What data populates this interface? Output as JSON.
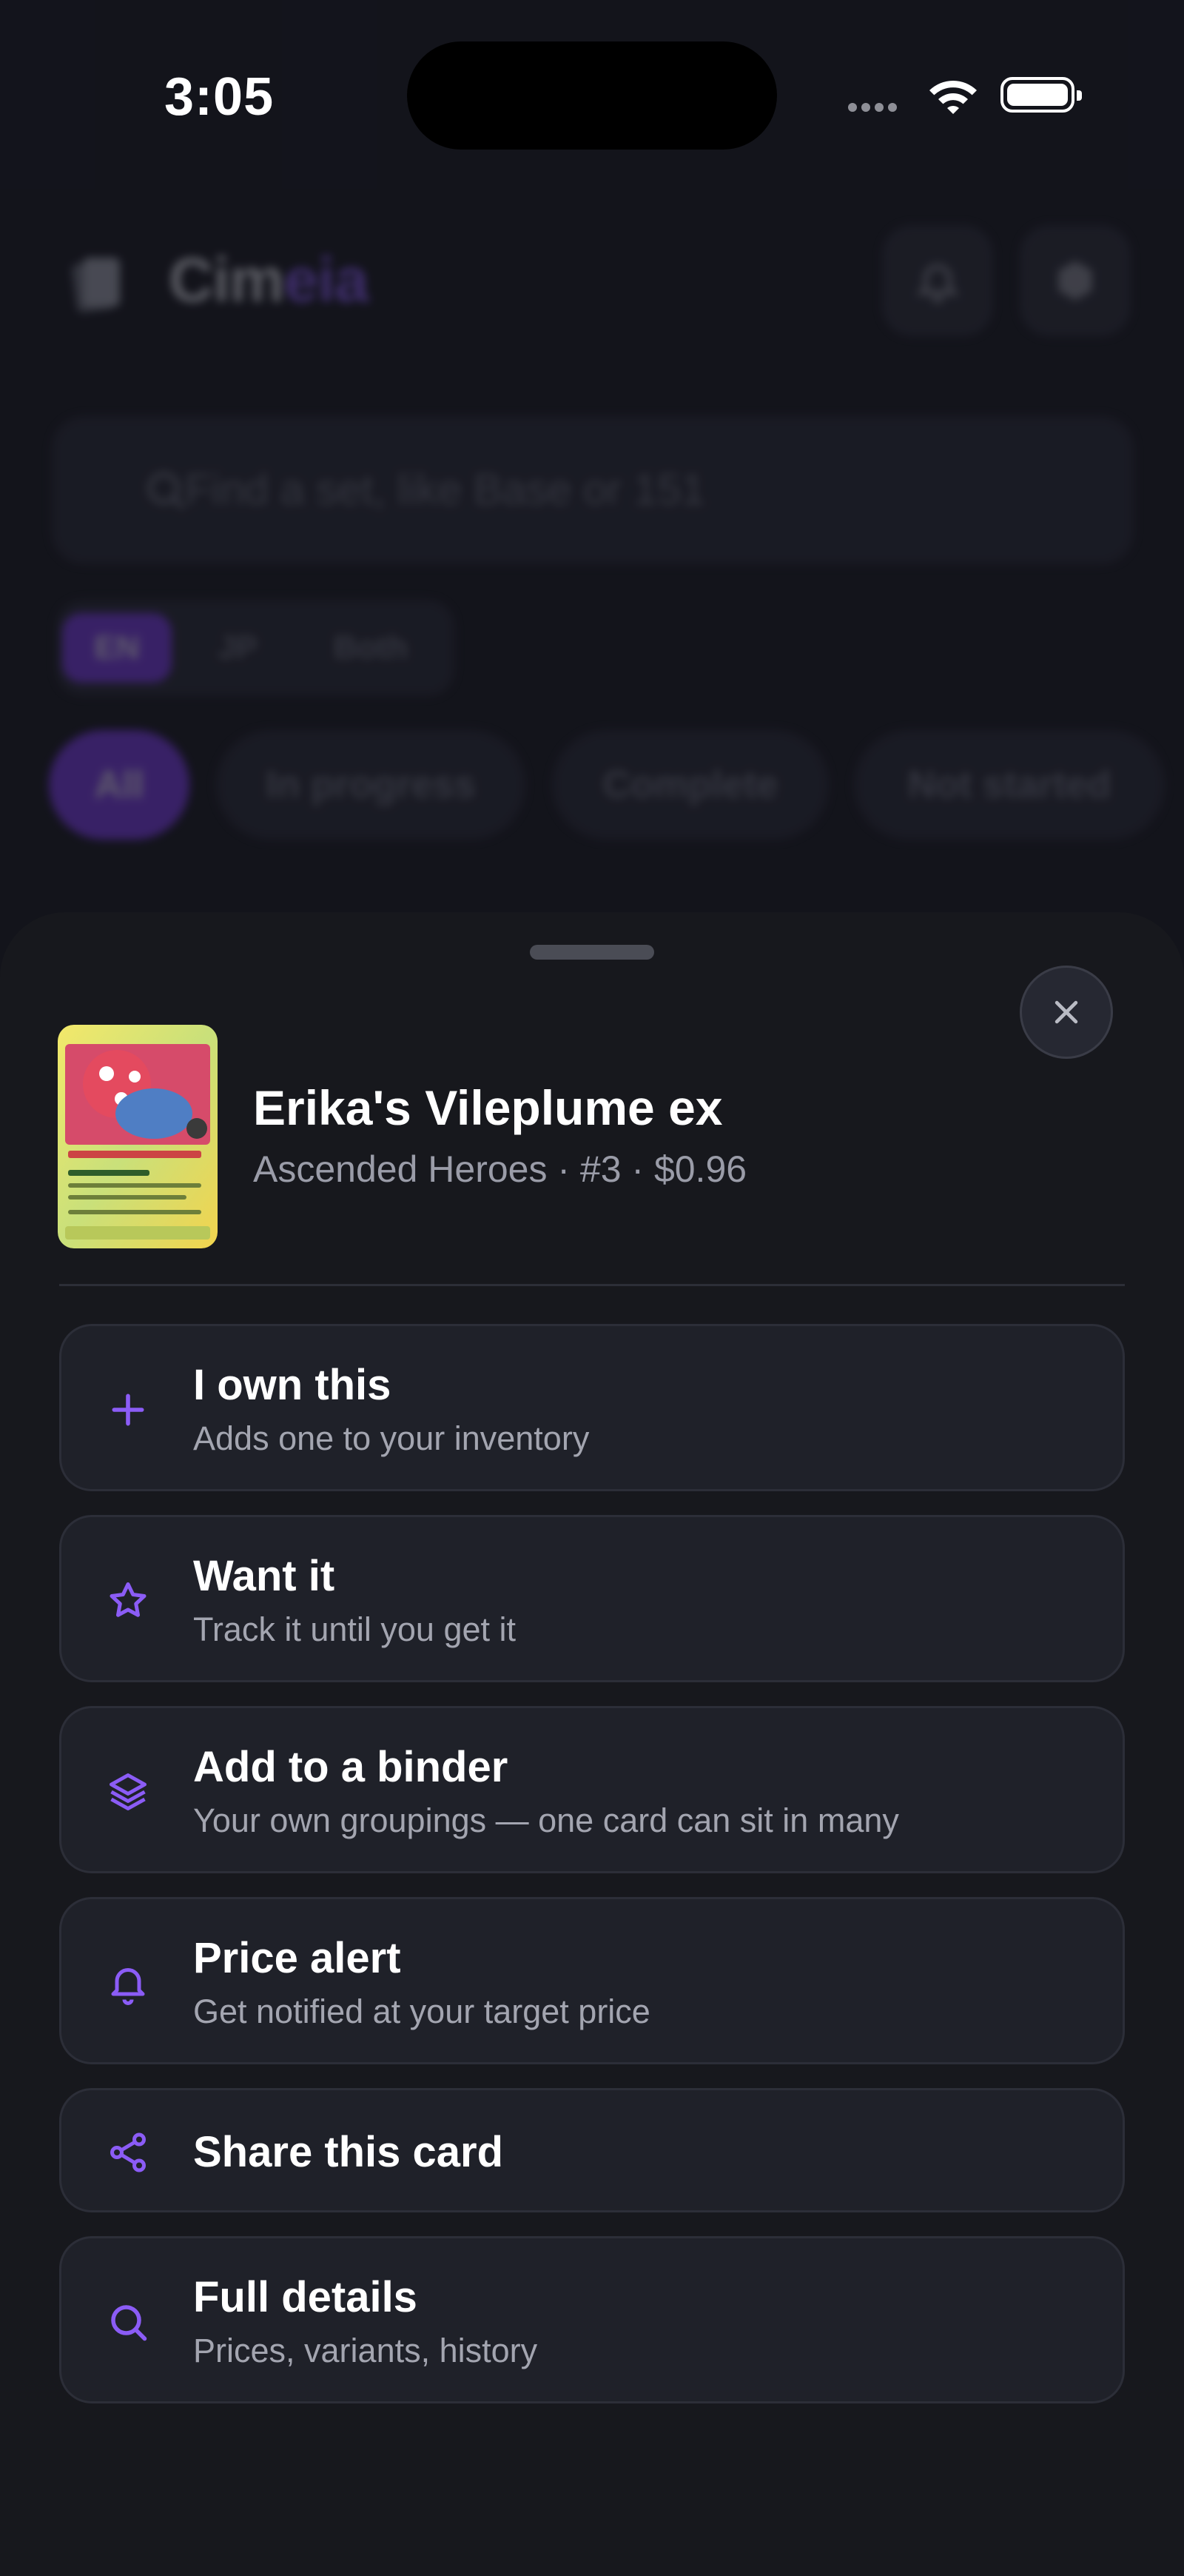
{
  "status_bar": {
    "time": "3:05"
  },
  "app": {
    "logo_text_a": "Cim",
    "logo_text_b": "eia",
    "search_placeholder": "Find a set, like Base or 151",
    "language_options": [
      "EN",
      "JP",
      "Both"
    ],
    "filter_chips": [
      "All",
      "In progress",
      "Complete",
      "Not started"
    ]
  },
  "sheet": {
    "card_name": "Erika's Vileplume ex",
    "card_meta": "Ascended Heroes · #3 · $0.96",
    "actions": [
      {
        "title": "I own this",
        "subtitle": "Adds one to your inventory",
        "icon": "plus-icon"
      },
      {
        "title": "Want it",
        "subtitle": "Track it until you get it",
        "icon": "star-icon"
      },
      {
        "title": "Add to a binder",
        "subtitle": "Your own groupings — one card can sit in many",
        "icon": "layers-icon"
      },
      {
        "title": "Price alert",
        "subtitle": "Get notified at your target price",
        "icon": "bell-icon"
      },
      {
        "title": "Share this card",
        "subtitle": "",
        "icon": "share-icon"
      },
      {
        "title": "Full details",
        "subtitle": "Prices, variants, history",
        "icon": "search-icon"
      }
    ]
  },
  "colors": {
    "accent": "#8b5cf6",
    "sheet_bg": "#17181d",
    "row_bg": "#1f2129",
    "text_muted": "#a3a5b0"
  }
}
